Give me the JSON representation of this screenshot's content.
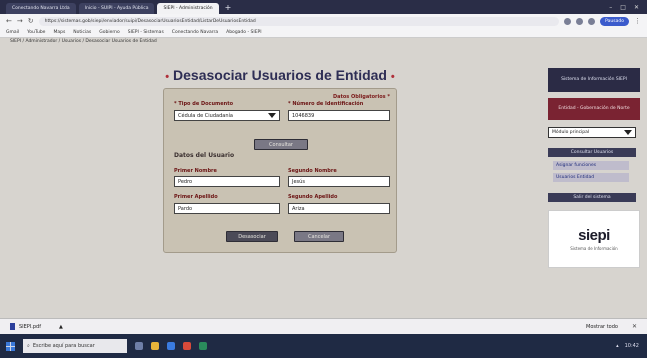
{
  "browser": {
    "tabs": [
      {
        "label": "Conectando Navarra Ltda",
        "active": false
      },
      {
        "label": "Inicio - SUIPI - Ayuda Pública",
        "active": false
      },
      {
        "label": "SIEPI - Administración",
        "active": true
      }
    ],
    "url": "https://sistemas.gob/siepi/enviador/suipi/DesasociarUsuariosEntidad/ListarDeUsuariosEntidad",
    "profile_label": "Pausado",
    "bookmarks": [
      "Gmail",
      "YouTube",
      "Maps",
      "Noticias",
      "Gobierno",
      "SIEPI - Sistemas",
      "Conectando Navarra",
      "Abogado - SIEPI"
    ],
    "breadcrumb": "SIEPI / Administrador / Usuarios / Desasociar Usuarios de Entidad"
  },
  "form": {
    "title": "Desasociar Usuarios de Entidad",
    "required_note": "Datos Obligatorios *",
    "doc_type_label": "* Tipo de Documento",
    "doc_type_value": "Cédula de Ciudadanía",
    "id_number_label": "* Número de Identificación",
    "id_number_value": "1046839",
    "search_button": "Consultar",
    "user_section_title": "Datos del Usuario",
    "first_name_label": "Primer Nombre",
    "first_name_value": "Pedro",
    "second_name_label": "Segundo Nombre",
    "second_name_value": "Jesús",
    "first_surname_label": "Primer Apellido",
    "first_surname_value": "Pardo",
    "second_surname_label": "Segundo Apellido",
    "second_surname_value": "Ariza",
    "dissociate_button": "Desasociar",
    "cancel_button": "Cancelar"
  },
  "sidebar": {
    "box1": "Sistema de Información SIEPI",
    "box2": "Entidad - Gobernación de Norte",
    "select_value": "Módulo principal",
    "section_label": "Consultar Usuarios",
    "link1": "Asignar funciones",
    "link2": "Usuarios Entidad",
    "section2_label": "Salir del sistema",
    "logo_text": "siepi",
    "logo_sub": "Sistema de Información"
  },
  "downloads": {
    "file_name": "SIEPI.pdf",
    "show_all": "Mostrar todo"
  },
  "taskbar": {
    "search_placeholder": "Escribe aquí para buscar",
    "clock": "10:42"
  },
  "colors": {
    "title": "#2e2e55",
    "label_red": "#6b1313",
    "sidebar_dark": "#2b2b45",
    "sidebar_red": "#7a2332",
    "taskbar": "#1f2a44"
  }
}
